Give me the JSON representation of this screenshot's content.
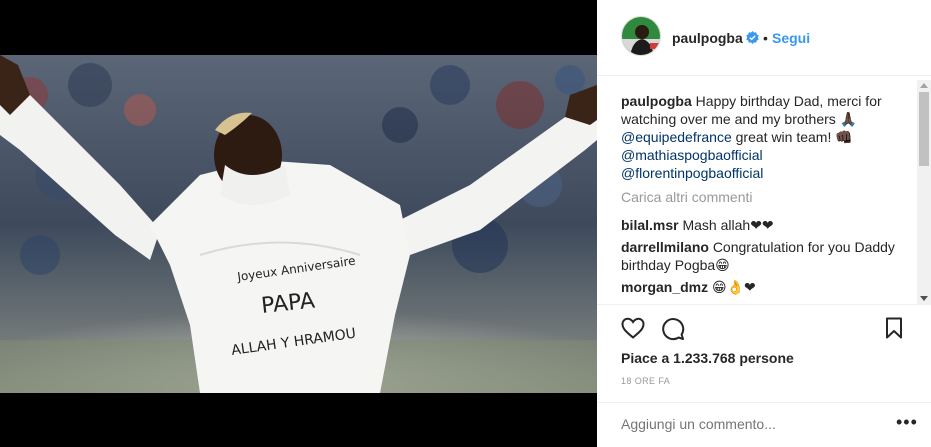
{
  "post": {
    "username": "paulpogba",
    "follow_label": "Segui",
    "dot": "•",
    "caption": {
      "user": "paulpogba",
      "text1": "Happy birthday Dad, merci for watching over me and my brothers",
      "emoji1": "🙏🏿",
      "mention1": "@equipedefrance",
      "text2": "great win team!",
      "emoji2": "👊🏿",
      "mention2": "@mathiaspogbaofficial",
      "mention3": "@florentinpogbaofficial"
    },
    "load_more": "Carica altri commenti",
    "comments": [
      {
        "user": "bilal.msr",
        "text": "Mash allah❤❤"
      },
      {
        "user": "darrellmilano",
        "text": "Congratulation for you Daddy birthday Pogba😁"
      },
      {
        "user": "morgan_dmz",
        "text": "😁👌❤"
      }
    ],
    "likes": "Piace a 1.233.768 persone",
    "time": "18 ORE FA",
    "add_comment_placeholder": "Aggiungi un commento...",
    "more_dots": "•••"
  },
  "photo": {
    "shirt_line1": "Joyeux Anniversaire",
    "shirt_line2": "PAPA",
    "shirt_line3": "ALLAH Y HRAMOU"
  },
  "colors": {
    "link": "#3897f0",
    "mention": "#003569",
    "verified": "#3897f0"
  }
}
